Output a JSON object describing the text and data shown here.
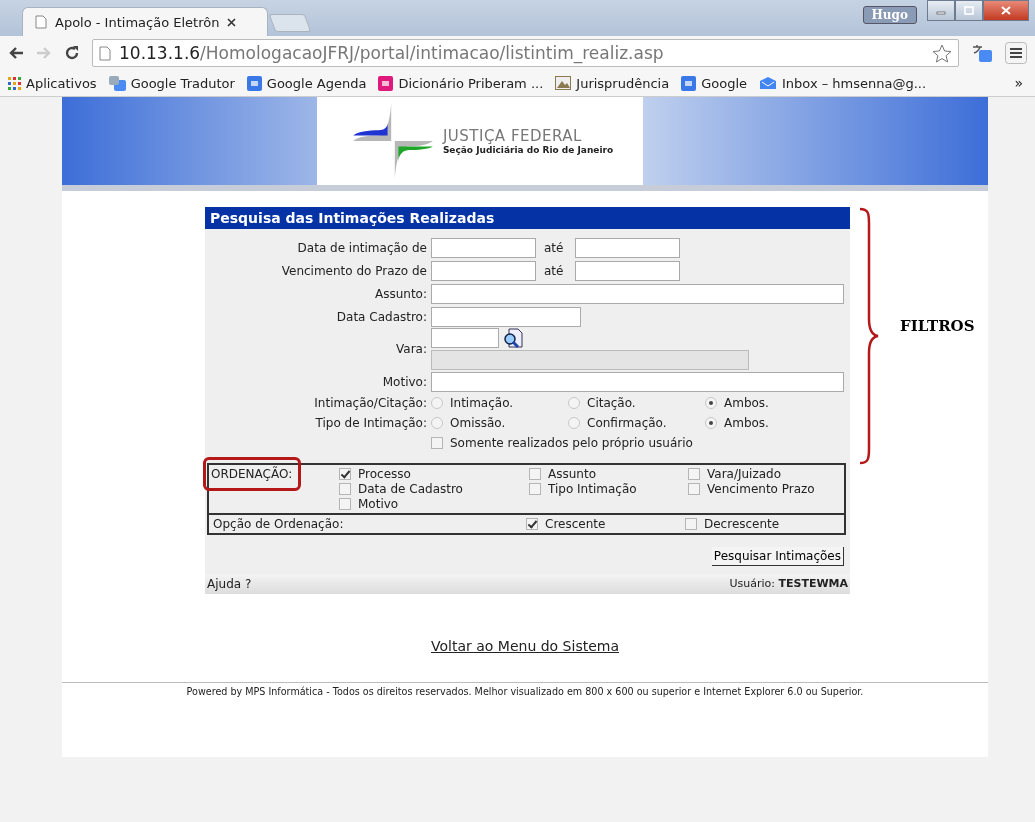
{
  "browser": {
    "tab_title": "Apolo - Intimação Eletrôn",
    "user": "Hugo",
    "address_host": "10.13.1.6",
    "address_path": "/HomologacaoJFRJ/portal/intimacao/listintim_realiz.asp",
    "bookmarks": [
      {
        "label": "Aplicativos",
        "kind": "apps"
      },
      {
        "label": "Google Tradutor",
        "kind": "translate"
      },
      {
        "label": "Google Agenda",
        "kind": "calendar"
      },
      {
        "label": "Dicionário Priberam ...",
        "kind": "dictionary"
      },
      {
        "label": "Jurisprudência",
        "kind": "image"
      },
      {
        "label": "Google",
        "kind": "google"
      },
      {
        "label": "Inbox – hmsenna@g...",
        "kind": "inbox"
      }
    ],
    "more": "»"
  },
  "banner": {
    "title": "JUSTIÇA FEDERAL",
    "subtitle": "Seção Judiciária do Rio de Janeiro"
  },
  "form": {
    "title": "Pesquisa das Intimações Realizadas",
    "date_rows": [
      {
        "label": "Data de intimação de",
        "to": "até"
      },
      {
        "label": "Vencimento do Prazo de",
        "to": "até"
      }
    ],
    "assunto": "Assunto:",
    "data_cadastro": "Data Cadastro:",
    "vara": "Vara:",
    "motivo": "Motivo:",
    "radio_groups": [
      {
        "label": "Intimação/Citação:",
        "options": [
          {
            "label": "Intimação.",
            "selected": false
          },
          {
            "label": "Citação.",
            "selected": false
          },
          {
            "label": "Ambos.",
            "selected": true
          }
        ]
      },
      {
        "label": "Tipo de Intimação:",
        "options": [
          {
            "label": "Omissão.",
            "selected": false
          },
          {
            "label": "Confirmação.",
            "selected": false
          },
          {
            "label": "Ambos.",
            "selected": true
          }
        ]
      }
    ],
    "own_only": {
      "label": "Somente realizados pelo próprio usuário",
      "checked": false
    },
    "ordering": {
      "label": "ORDENAÇÃO:",
      "options": [
        {
          "label": "Processo",
          "checked": true
        },
        {
          "label": "Assunto",
          "checked": false
        },
        {
          "label": "Vara/Juizado",
          "checked": false
        },
        {
          "label": "Data de Cadastro",
          "checked": false
        },
        {
          "label": "Tipo Intimação",
          "checked": false
        },
        {
          "label": "Vencimento Prazo",
          "checked": false
        },
        {
          "label": "Motivo",
          "checked": false
        }
      ]
    },
    "order_option": {
      "label": "Opção de Ordenação:",
      "options": [
        {
          "label": "Crescente",
          "checked": true
        },
        {
          "label": "Decrescente",
          "checked": false
        }
      ]
    },
    "submit": "Pesquisar Intimações",
    "help": "Ajuda ?",
    "user_label": "Usuário:",
    "user_name": "TESTEWMA"
  },
  "back_link": "Voltar ao Menu do Sistema",
  "footer": "Powered by MPS Informática - Todos os direitos reservados. Melhor visualizado em 800 x 600 ou superior e Internet Explorer 6.0 ou Superior.",
  "annotation": {
    "label": "FILTROS"
  }
}
